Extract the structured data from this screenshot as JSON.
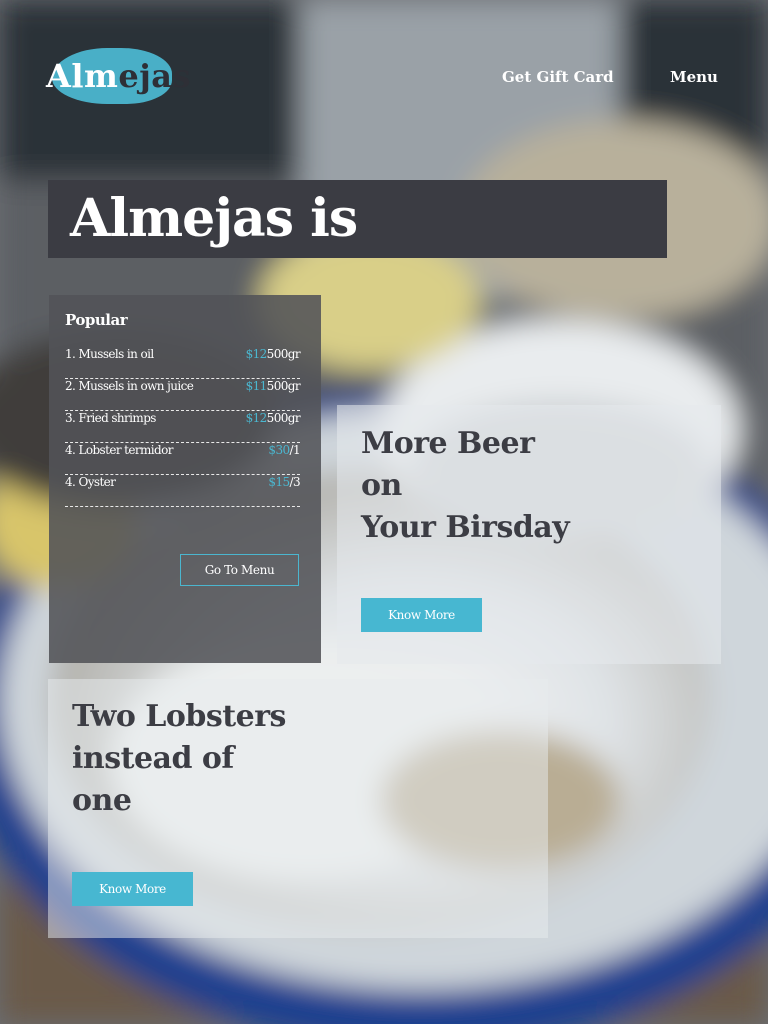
{
  "header": {
    "logo_main": "Alm",
    "logo_accent": "ejas",
    "nav": [
      "Get Gift Card",
      "Menu"
    ]
  },
  "hero": {
    "title": "Almejas is"
  },
  "popular": {
    "title": "Popular",
    "items": [
      {
        "name": "1. Mussels in oil",
        "price": "$12",
        "qty": "500gr"
      },
      {
        "name": "2. Mussels in own juice",
        "price": "$11",
        "qty": "500gr"
      },
      {
        "name": "3. Fried shrimps",
        "price": "$12",
        "qty": "500gr"
      },
      {
        "name": "4. Lobster termidor",
        "price": "$30",
        "qty": "/1"
      },
      {
        "name": "4. Oyster",
        "price": "$15",
        "qty": "/3"
      }
    ],
    "button": "Go To Menu"
  },
  "promo_beer": {
    "title_lines": [
      "More Beer",
      "on",
      "Your Birsday"
    ],
    "button": "Know More"
  },
  "promo_lobster": {
    "title_lines": [
      "Two Lobsters",
      "instead of",
      "one"
    ],
    "button": "Know More"
  },
  "colors": {
    "accent": "#47b7d1",
    "dark": "#3b3c43",
    "text_dark": "#3c3d44"
  }
}
